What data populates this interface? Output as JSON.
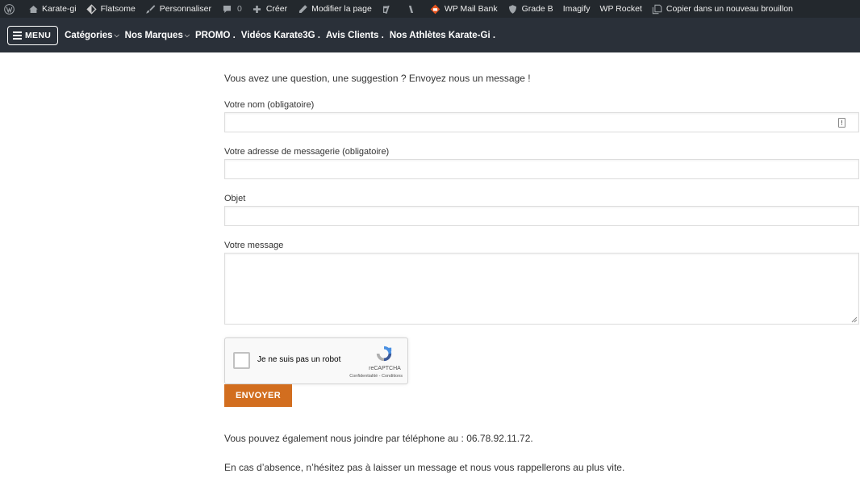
{
  "adminbar": {
    "items": [
      {
        "icon": "wordpress-icon",
        "label": ""
      },
      {
        "icon": "home-icon",
        "label": "Karate-gi"
      },
      {
        "icon": "flatsome-icon",
        "label": "Flatsome"
      },
      {
        "icon": "brush-icon",
        "label": "Personnaliser"
      },
      {
        "icon": "comment-icon",
        "label": "",
        "count": "0"
      },
      {
        "icon": "plus-icon",
        "label": "Créer"
      },
      {
        "icon": "pencil-icon",
        "label": "Modifier la page"
      },
      {
        "icon": "yoast-icon",
        "label": ""
      },
      {
        "icon": "code-icon",
        "label": ""
      },
      {
        "icon": "mail-bank-icon",
        "label": "WP Mail Bank"
      },
      {
        "icon": "shield-icon",
        "label": "Grade B"
      },
      {
        "icon": "",
        "label": "Imagify"
      },
      {
        "icon": "",
        "label": "WP Rocket"
      },
      {
        "icon": "copy-icon",
        "label": "Copier dans un nouveau brouillon"
      }
    ]
  },
  "header": {
    "menu_label": "MENU",
    "nav": [
      {
        "label": "Catégories",
        "dropdown": true
      },
      {
        "label": "Nos Marques",
        "dropdown": true
      },
      {
        "label": "PROMO .",
        "dropdown": false
      },
      {
        "label": "Vidéos Karate3G .",
        "dropdown": false
      },
      {
        "label": "Avis Clients .",
        "dropdown": false
      },
      {
        "label": "Nos Athlètes Karate-Gi .",
        "dropdown": false
      }
    ]
  },
  "form": {
    "intro": "Vous avez une question, une suggestion ? Envoyez nous un message !",
    "name_label": "Votre nom (obligatoire)",
    "name_value": "",
    "email_label": "Votre adresse de messagerie (obligatoire)",
    "email_value": "",
    "subject_label": "Objet",
    "subject_value": "",
    "message_label": "Votre message",
    "message_value": "",
    "recaptcha": {
      "text": "Je ne suis pas un robot",
      "brand": "reCAPTCHA",
      "links": "Confidentialité - Conditions"
    },
    "submit_label": "ENVOYER"
  },
  "footer_text": {
    "phone": "Vous pouvez également nous joindre par téléphone au : 06.78.92.11.72.",
    "absence": "En cas d’absence, n’hésitez pas à laisser un message et nous vous rappellerons au plus vite."
  },
  "colors": {
    "adminbar_bg": "#23282d",
    "header_bg": "#2a3039",
    "submit_bg": "#d26e1f"
  }
}
